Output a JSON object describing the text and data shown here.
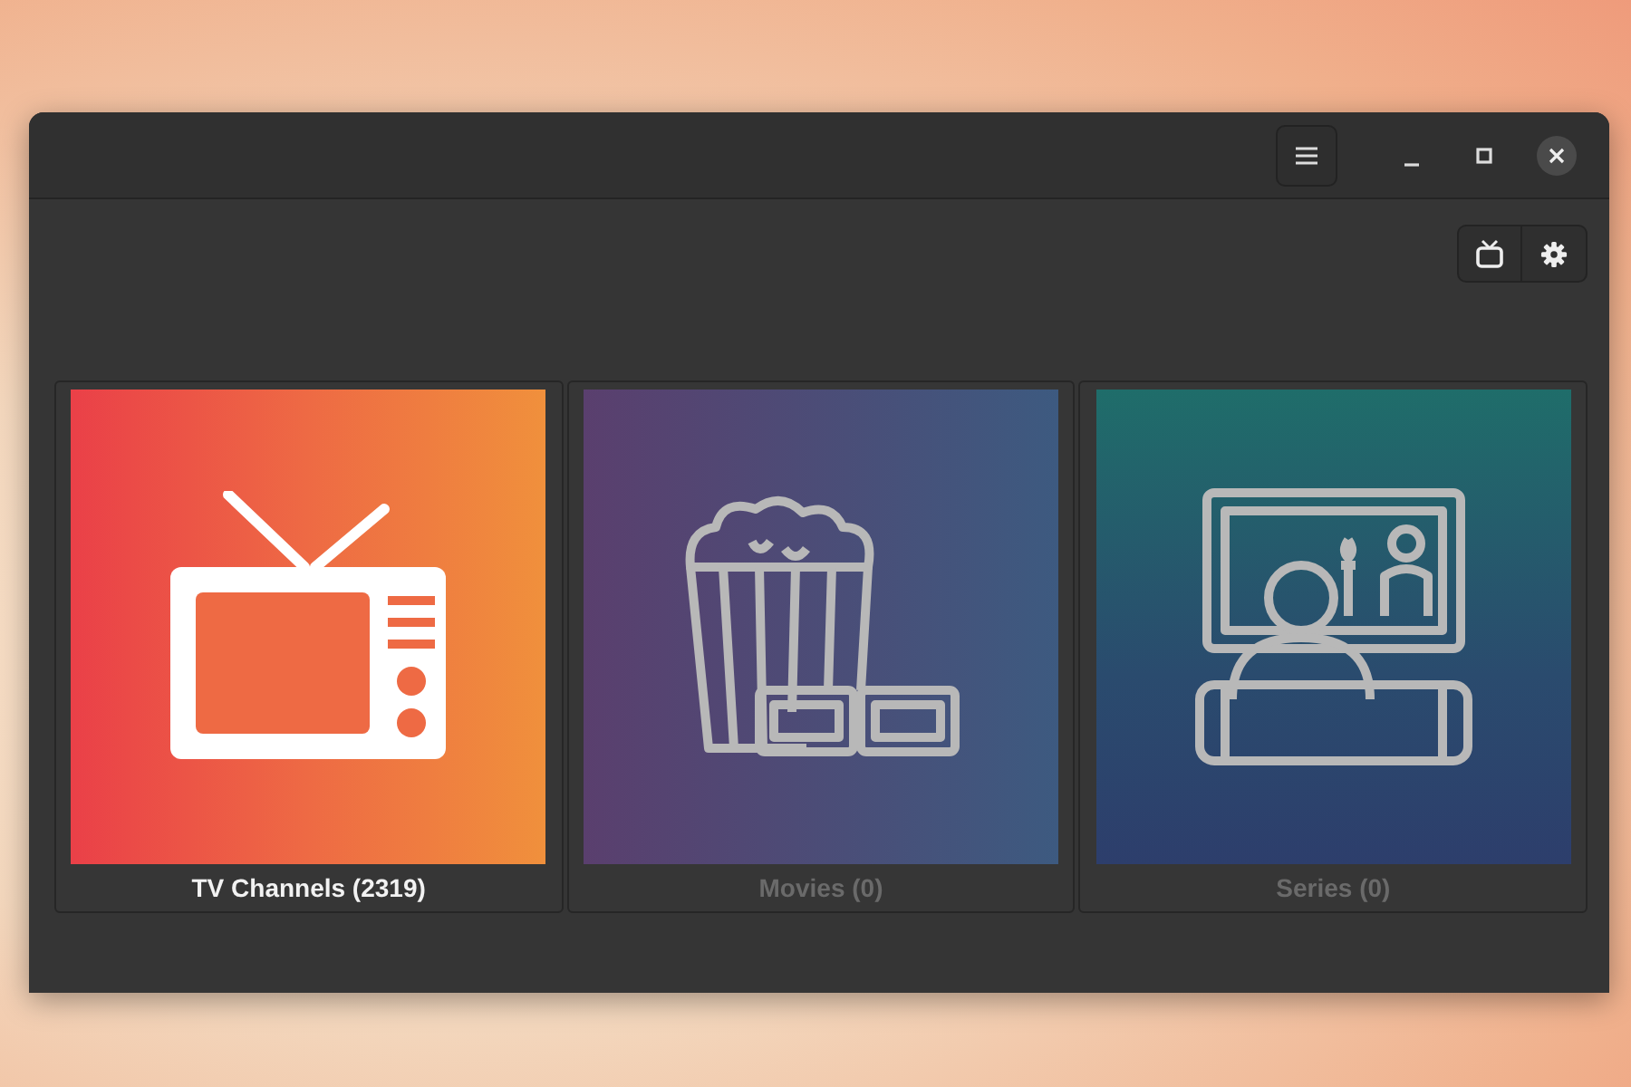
{
  "window": {
    "header_buttons": [
      {
        "kind": "menu"
      },
      {
        "kind": "minimize"
      },
      {
        "kind": "maximize"
      },
      {
        "kind": "close"
      }
    ]
  },
  "toolbar": {
    "buttons": [
      {
        "kind": "tv"
      },
      {
        "kind": "settings"
      }
    ]
  },
  "tiles": [
    {
      "kind": "tv",
      "label": "TV Channels (2319)",
      "disabled": false
    },
    {
      "kind": "movies",
      "label": "Movies (0)",
      "disabled": true
    },
    {
      "kind": "series",
      "label": "Series (0)",
      "disabled": true
    }
  ]
}
